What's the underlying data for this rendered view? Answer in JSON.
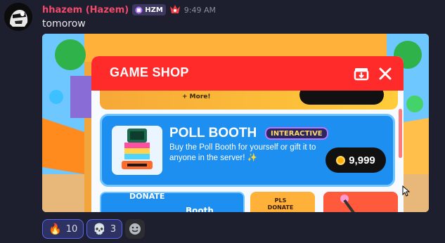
{
  "message": {
    "username": "hhazem (Hazem)",
    "guild_tag": "HZM",
    "timestamp": "9:49 AM",
    "text": "tomorow"
  },
  "shop": {
    "title": "GAME SHOP",
    "top_item_more": "+ More!",
    "poll_booth": {
      "title": "POLL BOOTH",
      "badge": "INTERACTIVE",
      "description": "Buy the Poll Booth for yourself or gift it to anyone in the server! ✨",
      "price": "9,999"
    },
    "donate_label": "DONATE",
    "booth_label": "Booth",
    "pls_donate_line1": "PLS",
    "pls_donate_line2": "DONATE"
  },
  "reactions": [
    {
      "emoji": "🔥",
      "count": "10"
    },
    {
      "emoji": "💀",
      "count": "3"
    }
  ],
  "colors": {
    "username": "#f24a6b",
    "shop_header": "#ff2b2b",
    "poll_card": "#1d8ff0",
    "reaction_active_border": "#5865f2"
  }
}
